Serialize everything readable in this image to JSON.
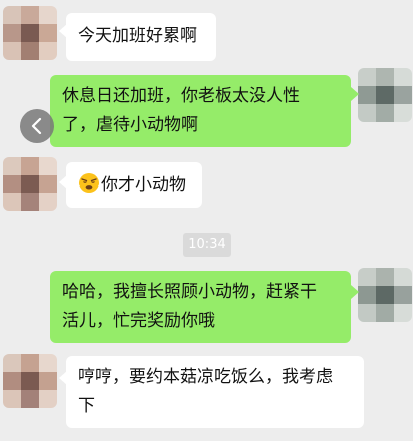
{
  "messages": [
    {
      "id": 1,
      "side": "in",
      "text": "今天加班好累啊"
    },
    {
      "id": 2,
      "side": "out",
      "line1": "休息日还加班，你老板太没人性",
      "line2": "了，虐待小动物啊"
    },
    {
      "id": 3,
      "side": "in",
      "emoji": "pouting-face-icon",
      "text": "你才小动物"
    },
    {
      "id": 4,
      "side": "out",
      "line1": "哈哈，我擅长照顾小动物，赶紧干",
      "line2": "活儿，忙完奖励你哦"
    },
    {
      "id": 5,
      "side": "in",
      "line1": "哼哼，要约本菇凉吃饭么，我考虑",
      "line2": "下"
    }
  ],
  "timestamp": "10:34",
  "colors": {
    "background": "#ededed",
    "incoming_bubble": "#ffffff",
    "outgoing_bubble": "#95ec69",
    "time_badge": "#dadada"
  }
}
